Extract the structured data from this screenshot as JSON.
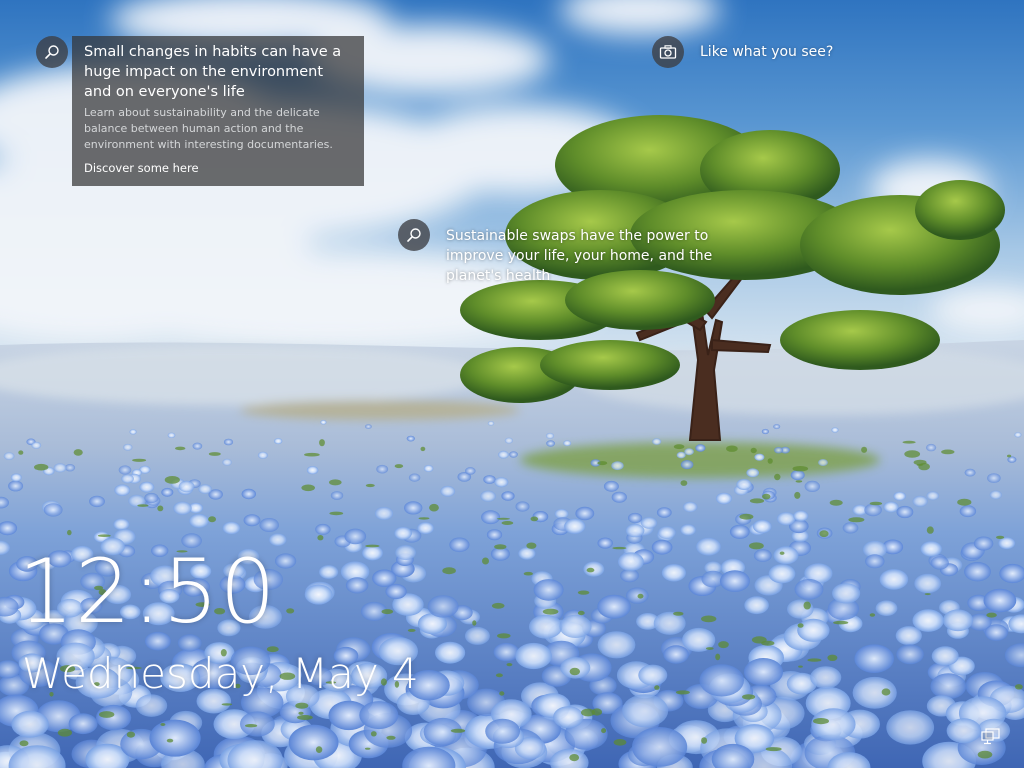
{
  "lock_screen": {
    "tips": [
      {
        "title": "Small changes in habits can have a huge impact on the environment and on everyone's life",
        "description": "Learn about sustainability and the delicate balance between human action and the environment with interesting documentaries.",
        "link": "Discover some here",
        "icon": "search-icon"
      },
      {
        "title": "Sustainable swaps have the power to improve your life, your home, and the planet's health",
        "icon": "search-icon"
      }
    ],
    "like_prompt": {
      "label": "Like what you see?",
      "icon": "camera-icon"
    },
    "clock": {
      "time": "12:50",
      "date": "Wednesday, May 4"
    },
    "status": {
      "network_icon": "network-icon"
    },
    "background": {
      "description_icon": "landscape-photo",
      "colors": {
        "sky_top": "#3a7fc4",
        "sky_low": "#a9c9e6",
        "cloud": "#eef2f6",
        "field_far": "#b8c8dc",
        "flowers": "#6f97d6",
        "tree_foliage": "#5f8a2a",
        "trunk": "#4a2e1e"
      }
    }
  }
}
